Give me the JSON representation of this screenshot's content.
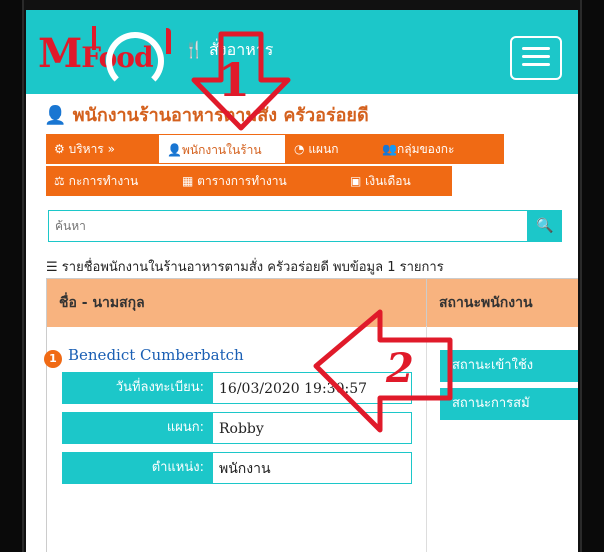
{
  "header": {
    "logo_text_m": "M",
    "logo_text_food": "Food",
    "brand_sub": "สั่งอาหาร"
  },
  "page_title": "พนักงานร้านอาหารตามสั่ง ครัวอร่อยดี",
  "tabs": [
    {
      "label": "บริหาร »",
      "icon": "gear-icon",
      "active": false
    },
    {
      "label": "พนักงานในร้าน",
      "icon": "user-icon",
      "active": true
    },
    {
      "label": "แผนก",
      "icon": "pie-icon",
      "active": false
    },
    {
      "label": "กลุ่มของกะ",
      "icon": "users-icon",
      "active": false
    },
    {
      "label": "กะการทำงาน",
      "icon": "scale-icon",
      "active": false
    },
    {
      "label": "ตารางการทำงาน",
      "icon": "calendar-icon",
      "active": false
    },
    {
      "label": "เงินเดือน",
      "icon": "money-icon",
      "active": false
    }
  ],
  "search": {
    "placeholder": "ค้นหา"
  },
  "result_info": "รายชื่อพนักงานในร้านอาหารตามสั่ง ครัวอร่อยดี พบข้อมูล 1 รายการ",
  "table": {
    "col_name": "ชื่อ - นามสกุล",
    "col_status": "สถานะพนักงาน"
  },
  "employee": {
    "number": "1",
    "name": "Benedict Cumberbatch",
    "reg_label": "วันที่ลงทะเบียน:",
    "reg_value": "16/03/2020 19:30:57",
    "dept_label": "แผนก:",
    "dept_value": "Robby",
    "pos_label": "ตำแหน่ง:",
    "pos_value": "พนักงาน",
    "status_login": "สถานะเข้าใช้ง",
    "status_member": "สถานะการสมั"
  },
  "annotations": {
    "arrow1": "1",
    "arrow2": "2"
  },
  "colors": {
    "teal": "#1cc7c9",
    "orange": "#f06a14",
    "red": "#e01a2a"
  }
}
